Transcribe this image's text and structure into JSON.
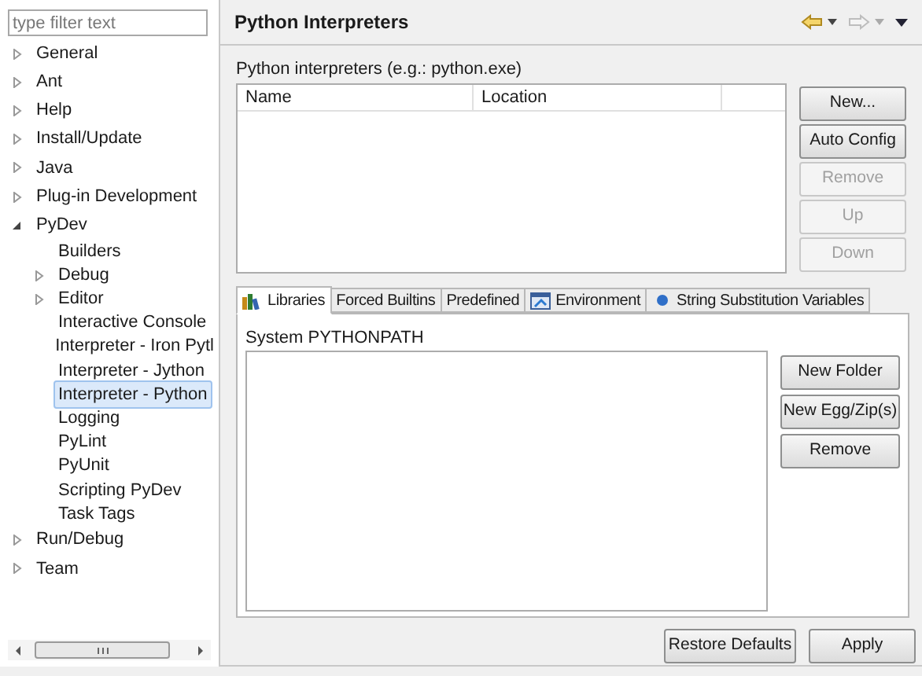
{
  "sidebar": {
    "filter": {
      "placeholder": "type filter text"
    },
    "tree": [
      {
        "label": "General",
        "kind": "folder",
        "expanded": false,
        "selected": false
      },
      {
        "label": "Ant",
        "kind": "folder",
        "expanded": false,
        "selected": false
      },
      {
        "label": "Help",
        "kind": "folder",
        "expanded": false,
        "selected": false
      },
      {
        "label": "Install/Update",
        "kind": "folder",
        "expanded": false,
        "selected": false
      },
      {
        "label": "Java",
        "kind": "folder",
        "expanded": false,
        "selected": false
      },
      {
        "label": "Plug-in Development",
        "kind": "folder",
        "expanded": false,
        "selected": false
      },
      {
        "label": "PyDev",
        "kind": "folder",
        "expanded": true,
        "selected": false,
        "children": [
          {
            "label": "Builders",
            "kind": "leaf",
            "selected": false
          },
          {
            "label": "Debug",
            "kind": "folder",
            "expanded": false,
            "selected": false
          },
          {
            "label": "Editor",
            "kind": "folder",
            "expanded": false,
            "selected": false
          },
          {
            "label": "Interactive Console",
            "kind": "leaf",
            "selected": false
          },
          {
            "label": "Interpreter - Iron Pytl",
            "kind": "leaf",
            "selected": false
          },
          {
            "label": "Interpreter - Jython",
            "kind": "leaf",
            "selected": false
          },
          {
            "label": "Interpreter - Python",
            "kind": "leaf",
            "selected": true
          },
          {
            "label": "Logging",
            "kind": "leaf",
            "selected": false
          },
          {
            "label": "PyLint",
            "kind": "leaf",
            "selected": false
          },
          {
            "label": "PyUnit",
            "kind": "leaf",
            "selected": false
          },
          {
            "label": "Scripting PyDev",
            "kind": "leaf",
            "selected": false
          },
          {
            "label": "Task Tags",
            "kind": "leaf",
            "selected": false
          }
        ]
      },
      {
        "label": "Run/Debug",
        "kind": "folder",
        "expanded": false,
        "selected": false
      },
      {
        "label": "Team",
        "kind": "folder",
        "expanded": false,
        "selected": false
      }
    ]
  },
  "page": {
    "title": "Python Interpreters",
    "nav": {
      "back_enabled": true,
      "forward_enabled": false
    },
    "interpreters_label": "Python interpreters (e.g.: python.exe)",
    "table": {
      "columns": [
        "Name",
        "Location"
      ]
    },
    "side_buttons": [
      {
        "label": "New...",
        "disabled": false
      },
      {
        "label": "Auto Config",
        "disabled": false
      },
      {
        "label": "Remove",
        "disabled": true
      },
      {
        "label": "Up",
        "disabled": true
      },
      {
        "label": "Down",
        "disabled": true
      }
    ],
    "tabs": [
      {
        "label": "Libraries",
        "kind": "books",
        "selected": true
      },
      {
        "label": "Forced Builtins",
        "kind": "plain",
        "selected": false
      },
      {
        "label": "Predefined",
        "kind": "plain",
        "selected": false
      },
      {
        "label": "Environment",
        "kind": "window",
        "selected": false
      },
      {
        "label": "String Substitution Variables",
        "kind": "dot",
        "selected": false
      }
    ],
    "path_label": "System PYTHONPATH",
    "path_buttons": [
      {
        "label": "New Folder",
        "disabled": false
      },
      {
        "label": "New Egg/Zip(s)",
        "disabled": false
      },
      {
        "label": "Remove",
        "disabled": false
      }
    ],
    "footer_buttons": [
      "Restore Defaults",
      "Apply"
    ]
  }
}
